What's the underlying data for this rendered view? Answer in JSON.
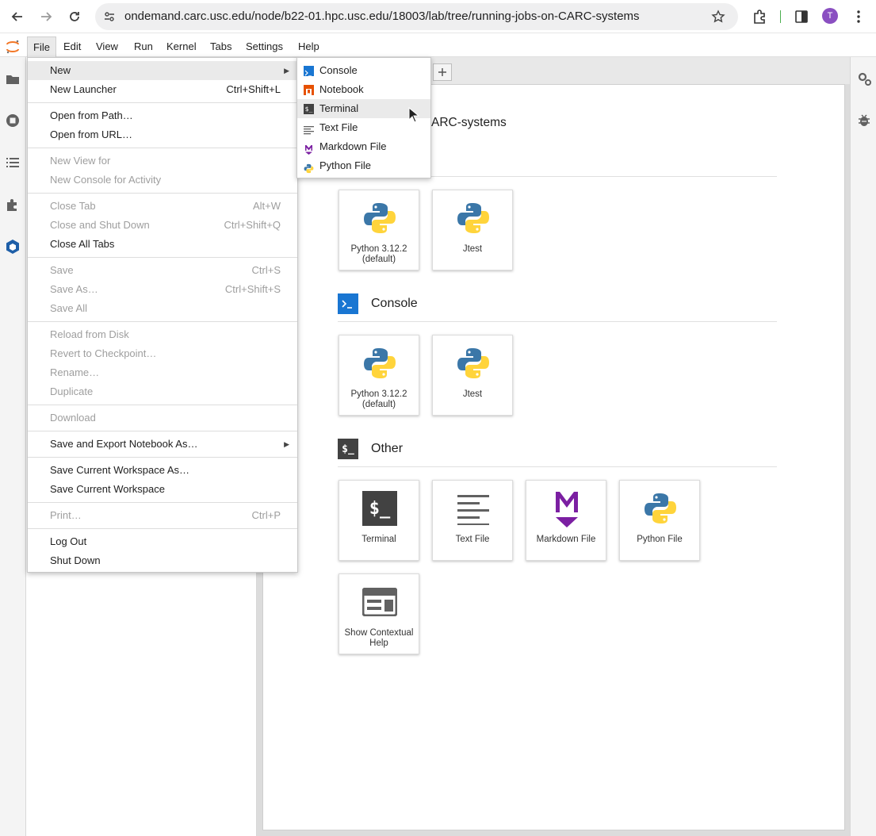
{
  "browser": {
    "url": "ondemand.carc.usc.edu/node/b22-01.hpc.usc.edu/18003/lab/tree/running-jobs-on-CARC-systems",
    "profile_initial": "T"
  },
  "menubar": {
    "items": [
      "File",
      "Edit",
      "View",
      "Run",
      "Kernel",
      "Tabs",
      "Settings",
      "Help"
    ]
  },
  "file_menu": {
    "items": [
      {
        "label": "New",
        "shortcut": ""
      },
      {
        "label": "New Launcher",
        "shortcut": "Ctrl+Shift+L"
      },
      {
        "label": "Open from Path…",
        "shortcut": ""
      },
      {
        "label": "Open from URL…",
        "shortcut": ""
      },
      {
        "label": "New View for",
        "shortcut": ""
      },
      {
        "label": "New Console for Activity",
        "shortcut": ""
      },
      {
        "label": "Close Tab",
        "shortcut": "Alt+W"
      },
      {
        "label": "Close and Shut Down",
        "shortcut": "Ctrl+Shift+Q"
      },
      {
        "label": "Close All Tabs",
        "shortcut": ""
      },
      {
        "label": "Save",
        "shortcut": "Ctrl+S"
      },
      {
        "label": "Save As…",
        "shortcut": "Ctrl+Shift+S"
      },
      {
        "label": "Save All",
        "shortcut": ""
      },
      {
        "label": "Reload from Disk",
        "shortcut": ""
      },
      {
        "label": "Revert to Checkpoint…",
        "shortcut": ""
      },
      {
        "label": "Rename…",
        "shortcut": ""
      },
      {
        "label": "Duplicate",
        "shortcut": ""
      },
      {
        "label": "Download",
        "shortcut": ""
      },
      {
        "label": "Save and Export Notebook As…",
        "shortcut": ""
      },
      {
        "label": "Save Current Workspace As…",
        "shortcut": ""
      },
      {
        "label": "Save Current Workspace",
        "shortcut": ""
      },
      {
        "label": "Print…",
        "shortcut": "Ctrl+P"
      },
      {
        "label": "Log Out",
        "shortcut": ""
      },
      {
        "label": "Shut Down",
        "shortcut": ""
      }
    ]
  },
  "new_submenu": {
    "items": [
      "Console",
      "Notebook",
      "Terminal",
      "Text File",
      "Markdown File",
      "Python File"
    ]
  },
  "launcher": {
    "heading_partial": "ARC-systems",
    "notebook_cards": [
      {
        "label_line1": "Python 3.12.2",
        "label_line2": "(default)"
      },
      {
        "label_line1": "Jtest",
        "label_line2": ""
      }
    ],
    "console_section": {
      "title": "Console"
    },
    "console_cards": [
      {
        "label_line1": "Python 3.12.2",
        "label_line2": "(default)"
      },
      {
        "label_line1": "Jtest",
        "label_line2": ""
      }
    ],
    "other_section": {
      "title": "Other"
    },
    "other_cards": [
      {
        "label_line1": "Terminal",
        "label_line2": ""
      },
      {
        "label_line1": "Text File",
        "label_line2": ""
      },
      {
        "label_line1": "Markdown File",
        "label_line2": ""
      },
      {
        "label_line1": "Python File",
        "label_line2": ""
      },
      {
        "label_line1": "Show Contextual",
        "label_line2": "Help"
      }
    ]
  },
  "colors": {
    "console_blue": "#1976d2",
    "terminal_dark": "#424242",
    "markdown_purple": "#7b1fa2",
    "notebook_orange": "#e65100",
    "python_blue": "#3b77a8",
    "python_yellow": "#ffd43b",
    "avatar_purple": "#8a4fc1"
  }
}
